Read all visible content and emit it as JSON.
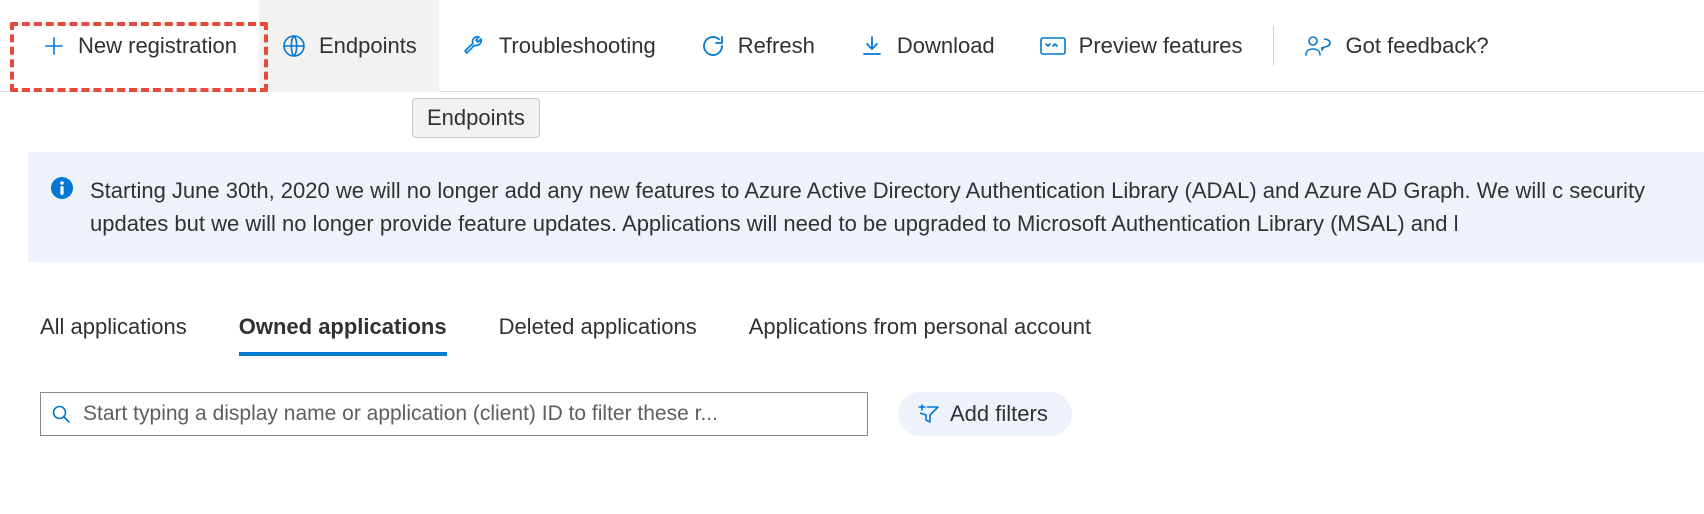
{
  "toolbar": {
    "new_registration": "New registration",
    "endpoints": "Endpoints",
    "troubleshooting": "Troubleshooting",
    "refresh": "Refresh",
    "download": "Download",
    "preview_features": "Preview features",
    "got_feedback": "Got feedback?"
  },
  "tooltip": "Endpoints",
  "info_message": "Starting June 30th, 2020 we will no longer add any new features to Azure Active Directory Authentication Library (ADAL) and Azure AD Graph. We will c security updates but we will no longer provide feature updates. Applications will need to be upgraded to Microsoft Authentication Library (MSAL) and l",
  "tabs": {
    "all": "All applications",
    "owned": "Owned applications",
    "deleted": "Deleted applications",
    "personal": "Applications from personal account"
  },
  "search": {
    "placeholder": "Start typing a display name or application (client) ID to filter these r..."
  },
  "filters": {
    "add_filters": "Add filters"
  },
  "colors": {
    "accent": "#0078d4",
    "highlight_border": "#e74a3b",
    "banner_bg": "#eef3fb"
  }
}
